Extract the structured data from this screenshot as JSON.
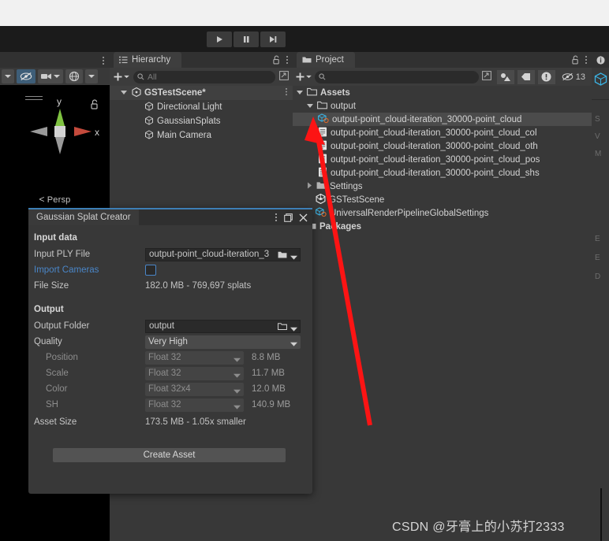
{
  "app": {
    "title": "Unity Editor",
    "watermark": "CSDN @牙膏上的小苏打2333"
  },
  "toolbar": {
    "play_label": "Play",
    "pause_label": "Pause",
    "step_label": "Step"
  },
  "scene_view": {
    "gizmo": {
      "axis_y": "y",
      "axis_x": "x",
      "projection": "Persp",
      "projection_prefix": "<"
    },
    "toolbar": {
      "visibility_label": "Toggle scene visibility",
      "camera_label": "Camera settings",
      "gizmos_label": "Gizmos"
    },
    "menu_label": "Scene view menu"
  },
  "hierarchy": {
    "tab_label": "Hierarchy",
    "search_placeholder": "All",
    "add_label": "+",
    "items": [
      {
        "label": "GSTestScene*",
        "depth": 0,
        "type": "scene",
        "bold": true
      },
      {
        "label": "Directional Light",
        "depth": 1,
        "type": "gameobject",
        "bold": false
      },
      {
        "label": "GaussianSplats",
        "depth": 1,
        "type": "gameobject",
        "bold": false
      },
      {
        "label": "Main Camera",
        "depth": 1,
        "type": "gameobject",
        "bold": false
      }
    ]
  },
  "project": {
    "tab_label": "Project",
    "search_placeholder": "",
    "warning_count": "13",
    "add_label": "+",
    "items": [
      {
        "label": "Assets",
        "depth": 0,
        "type": "folder",
        "bold": true,
        "expanded": true,
        "selected": false
      },
      {
        "label": "output",
        "depth": 1,
        "type": "folder",
        "bold": false,
        "expanded": true,
        "selected": false
      },
      {
        "label": "output-point_cloud-iteration_30000-point_cloud",
        "depth": 2,
        "type": "asset",
        "bold": false,
        "selected": true
      },
      {
        "label": "output-point_cloud-iteration_30000-point_cloud_col",
        "depth": 2,
        "type": "text",
        "bold": false,
        "selected": false
      },
      {
        "label": "output-point_cloud-iteration_30000-point_cloud_oth",
        "depth": 2,
        "type": "text",
        "bold": false,
        "selected": false
      },
      {
        "label": "output-point_cloud-iteration_30000-point_cloud_pos",
        "depth": 2,
        "type": "text",
        "bold": false,
        "selected": false
      },
      {
        "label": "output-point_cloud-iteration_30000-point_cloud_shs",
        "depth": 2,
        "type": "text",
        "bold": false,
        "selected": false
      },
      {
        "label": "Settings",
        "depth": 1,
        "type": "folder",
        "bold": false,
        "expanded": false,
        "selected": false
      },
      {
        "label": "GSTestScene",
        "depth": 1,
        "type": "scene",
        "bold": false,
        "selected": false
      },
      {
        "label": "UniversalRenderPipelineGlobalSettings",
        "depth": 1,
        "type": "asset",
        "bold": false,
        "selected": false
      },
      {
        "label": "Packages",
        "depth": 0,
        "type": "package",
        "bold": true,
        "expanded": false,
        "selected": false
      }
    ]
  },
  "dialog": {
    "title": "Gaussian Splat Creator",
    "close_label": "Close",
    "maximize_label": "Maximize",
    "menu_label": "Window menu",
    "sections": {
      "input_data": "Input data",
      "output": "Output"
    },
    "fields": {
      "input_ply_label": "Input PLY File",
      "input_ply_value": "output-point_cloud-iteration_3",
      "import_cameras_label": "Import Cameras",
      "import_cameras_checked": false,
      "file_size_label": "File Size",
      "file_size_value": "182.0 MB - 769,697 splats",
      "output_folder_label": "Output Folder",
      "output_folder_value": "output",
      "quality_label": "Quality",
      "quality_value": "Very High",
      "asset_size_label": "Asset Size",
      "asset_size_value": "173.5 MB - 1.05x smaller"
    },
    "format_rows": [
      {
        "label": "Position",
        "format": "Float 32",
        "size": "8.8 MB"
      },
      {
        "label": "Scale",
        "format": "Float 32",
        "size": "11.7 MB"
      },
      {
        "label": "Color",
        "format": "Float 32x4",
        "size": "12.0 MB"
      },
      {
        "label": "SH",
        "format": "Float 32",
        "size": "140.9 MB"
      }
    ],
    "create_button": "Create Asset"
  },
  "right_strip": {
    "info_label": "Info",
    "letters": [
      "S",
      "V",
      "M",
      "E",
      "E",
      "D"
    ]
  },
  "colors": {
    "accent": "#3d7eb5",
    "link": "#4a86c8",
    "arrow": "#fc1414",
    "panel_bg": "#383838",
    "tabbar_bg": "#313131",
    "selection": "#4b4b4b"
  }
}
